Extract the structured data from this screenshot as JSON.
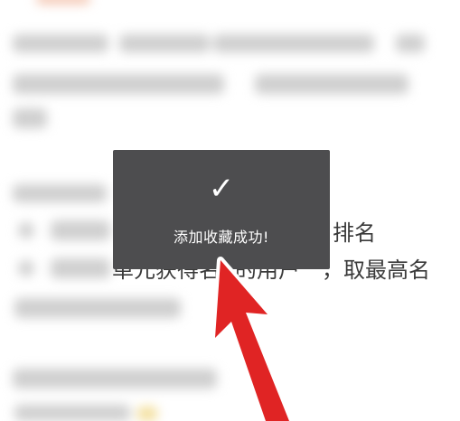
{
  "toast": {
    "check_icon": "checkmark",
    "message": "添加收藏成功!"
  },
  "content": {
    "line1_right": "排名",
    "line2_right": "，取最高名",
    "line2_left_partial": "单元获得名",
    "line2_mid_partial": "的用户"
  },
  "colors": {
    "toast_bg": "#4d4d4f",
    "arrow": "#e02424",
    "text": "#3a3a3a",
    "placeholder": "#cfcfcf"
  }
}
